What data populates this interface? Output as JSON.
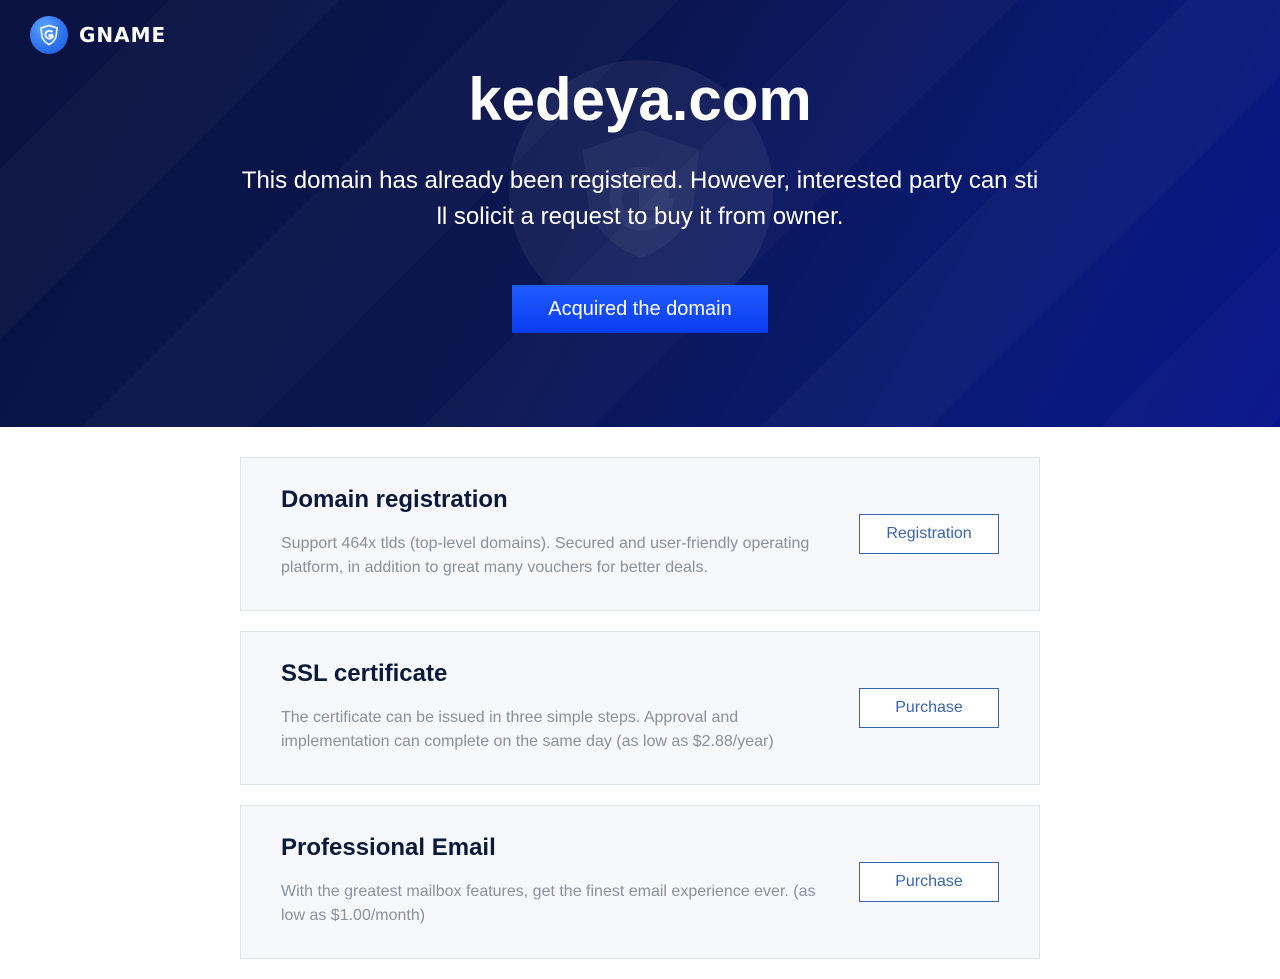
{
  "brand": {
    "name": "GNAME",
    "logo_icon": "gname-logo-icon"
  },
  "hero": {
    "domain": "kedeya.com",
    "message": "This domain has already been registered. However, interested party can still solicit a request to buy it from owner.",
    "cta_label": "Acquired the domain"
  },
  "services": [
    {
      "title": "Domain registration",
      "description": "Support 464x tlds (top-level domains). Secured and user-friendly operating platform, in addition to great many vouchers for better deals.",
      "button_label": "Registration"
    },
    {
      "title": "SSL certificate",
      "description": "The certificate can be issued in three simple steps. Approval and implementation can complete on the same day (as low as $2.88/year)",
      "button_label": "Purchase"
    },
    {
      "title": "Professional Email",
      "description": "With the greatest mailbox features, get the finest email experience ever. (as low as $1.00/month)",
      "button_label": "Purchase"
    }
  ],
  "colors": {
    "hero_bg": "#0a1240",
    "accent": "#1f5cff",
    "outline_button": "#3b63b0",
    "card_bg": "#f6f8fc"
  }
}
